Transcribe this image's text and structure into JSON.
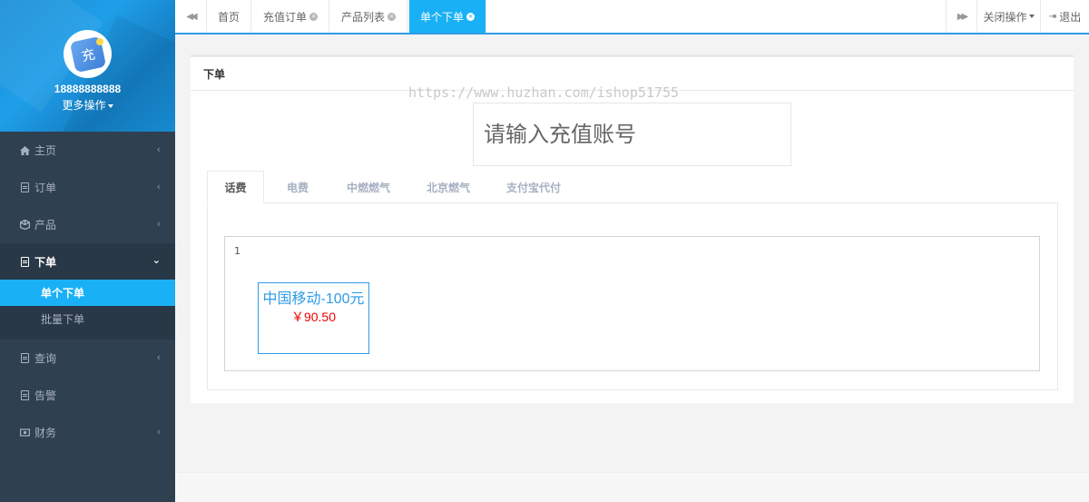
{
  "sidebar": {
    "username": "18888888888",
    "more_ops": "更多操作",
    "avatar_glyph": "充",
    "items": [
      {
        "label": "主页",
        "icon": "home-icon"
      },
      {
        "label": "订单",
        "icon": "document-icon"
      },
      {
        "label": "产品",
        "icon": "cube-icon"
      },
      {
        "label": "下单",
        "icon": "document-icon"
      },
      {
        "label": "查询",
        "icon": "document-icon"
      },
      {
        "label": "告警",
        "icon": "document-icon"
      },
      {
        "label": "财务",
        "icon": "money-icon"
      }
    ],
    "sub_items": [
      {
        "label": "单个下单"
      },
      {
        "label": "批量下单"
      }
    ]
  },
  "tabbar": {
    "tabs": [
      {
        "label": "首页"
      },
      {
        "label": "充值订单"
      },
      {
        "label": "产品列表"
      },
      {
        "label": "单个下单"
      }
    ],
    "close_ops": "关闭操作",
    "logout": "退出"
  },
  "panel": {
    "title": "下单",
    "watermark": "https://www.huzhan.com/ishop51755",
    "account_placeholder": "请输入充值账号",
    "tabs": [
      {
        "label": "话费"
      },
      {
        "label": "电费"
      },
      {
        "label": "中燃燃气"
      },
      {
        "label": "北京燃气"
      },
      {
        "label": "支付宝代付"
      }
    ],
    "group_name": "1",
    "product": {
      "name": "中国移动-100元",
      "price": "￥90.50"
    }
  },
  "colors": {
    "accent": "#1ab0f5",
    "sidebar": "#2f4050",
    "price": "#ee0000"
  }
}
